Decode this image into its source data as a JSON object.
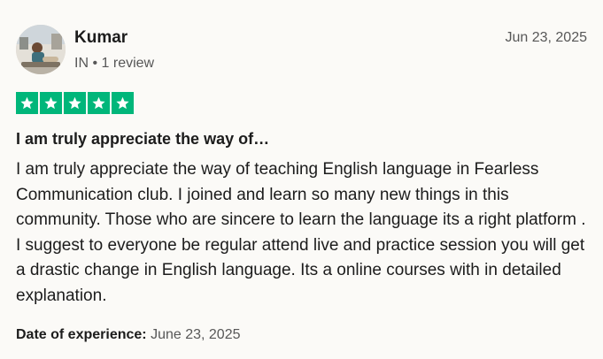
{
  "reviewer": {
    "name": "Kumar",
    "country": "IN",
    "separator": "•",
    "review_count": "1 review",
    "avatar_icon": "user-avatar-photo"
  },
  "review": {
    "date": "Jun 23, 2025",
    "rating": 5,
    "rating_max": 5,
    "star_color": "#00b67a",
    "title": "I am truly appreciate the way of…",
    "body": "I am truly appreciate the way of teaching English language in Fearless Communication club. I joined and learn so many new things in this community. Those who are sincere to learn the language its a right platform . I suggest to everyone be regular attend live and practice session you will get a drastic change in English language. Its a online courses with in detailed explanation.",
    "experience_label": "Date of experience:",
    "experience_date": "June 23, 2025"
  }
}
